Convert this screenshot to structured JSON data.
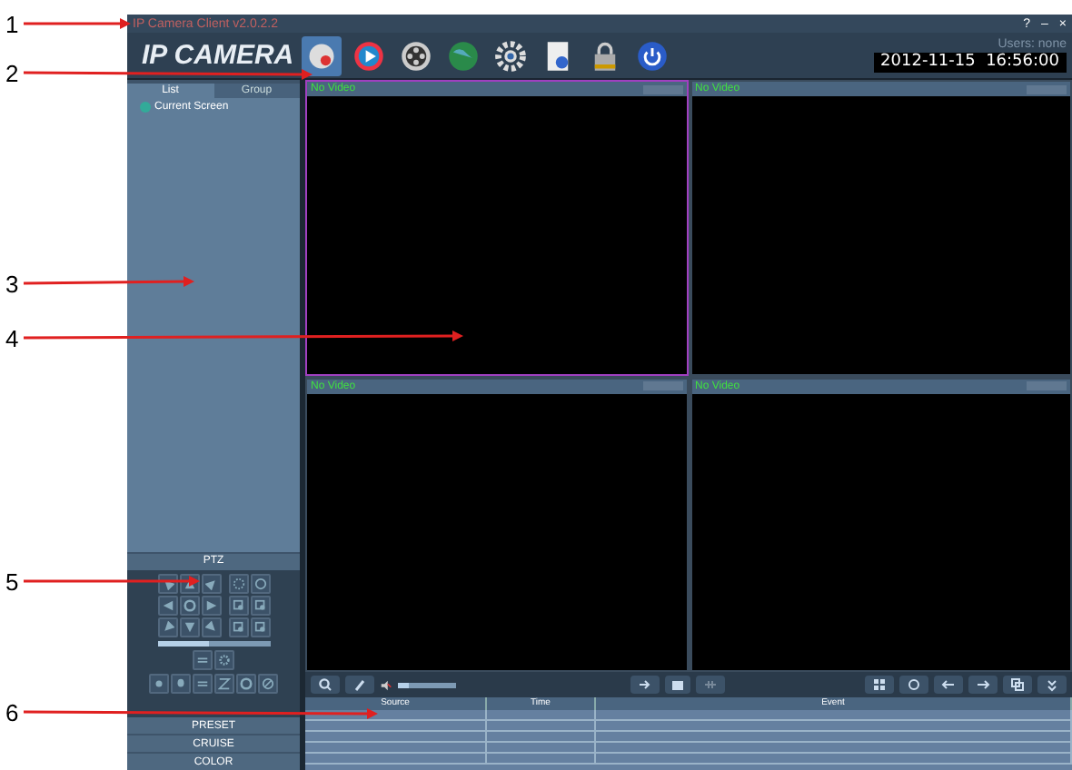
{
  "window": {
    "title": "IP Camera Client v2.0.2.2",
    "controls": [
      "?",
      "–",
      "×"
    ]
  },
  "header": {
    "logo": "IP CAMERA",
    "users": "Users: none",
    "datetime": "2012-11-15  16:56:00",
    "tools": [
      {
        "kind": "camera",
        "selected": true
      },
      {
        "kind": "play",
        "selected": false
      },
      {
        "kind": "reel",
        "selected": false
      },
      {
        "kind": "globe",
        "selected": false
      },
      {
        "kind": "gear",
        "selected": false
      },
      {
        "kind": "doc",
        "selected": false
      },
      {
        "kind": "lock",
        "selected": false
      },
      {
        "kind": "power",
        "selected": false
      }
    ]
  },
  "sidebar": {
    "tabs": [
      {
        "label": "List",
        "selected": true
      },
      {
        "label": "Group",
        "selected": false
      }
    ],
    "items": [
      "Current Screen"
    ],
    "ptz_title": "PTZ",
    "speed": {
      "level": 0.46
    },
    "buttons": [
      "PRESET",
      "CRUISE",
      "COLOR"
    ]
  },
  "videos": [
    {
      "label": "No Video",
      "selected": true
    },
    {
      "label": "No Video",
      "selected": false
    },
    {
      "label": "No Video",
      "selected": false
    },
    {
      "label": "No Video",
      "selected": false
    }
  ],
  "toolbar": {
    "volume": {
      "level": 0.2
    }
  },
  "events": {
    "columns": [
      "Source",
      "Time",
      "Event"
    ]
  },
  "annotations": [
    {
      "label": "1"
    },
    {
      "label": "2"
    },
    {
      "label": "3"
    },
    {
      "label": "4"
    },
    {
      "label": "5"
    },
    {
      "label": "6"
    }
  ]
}
